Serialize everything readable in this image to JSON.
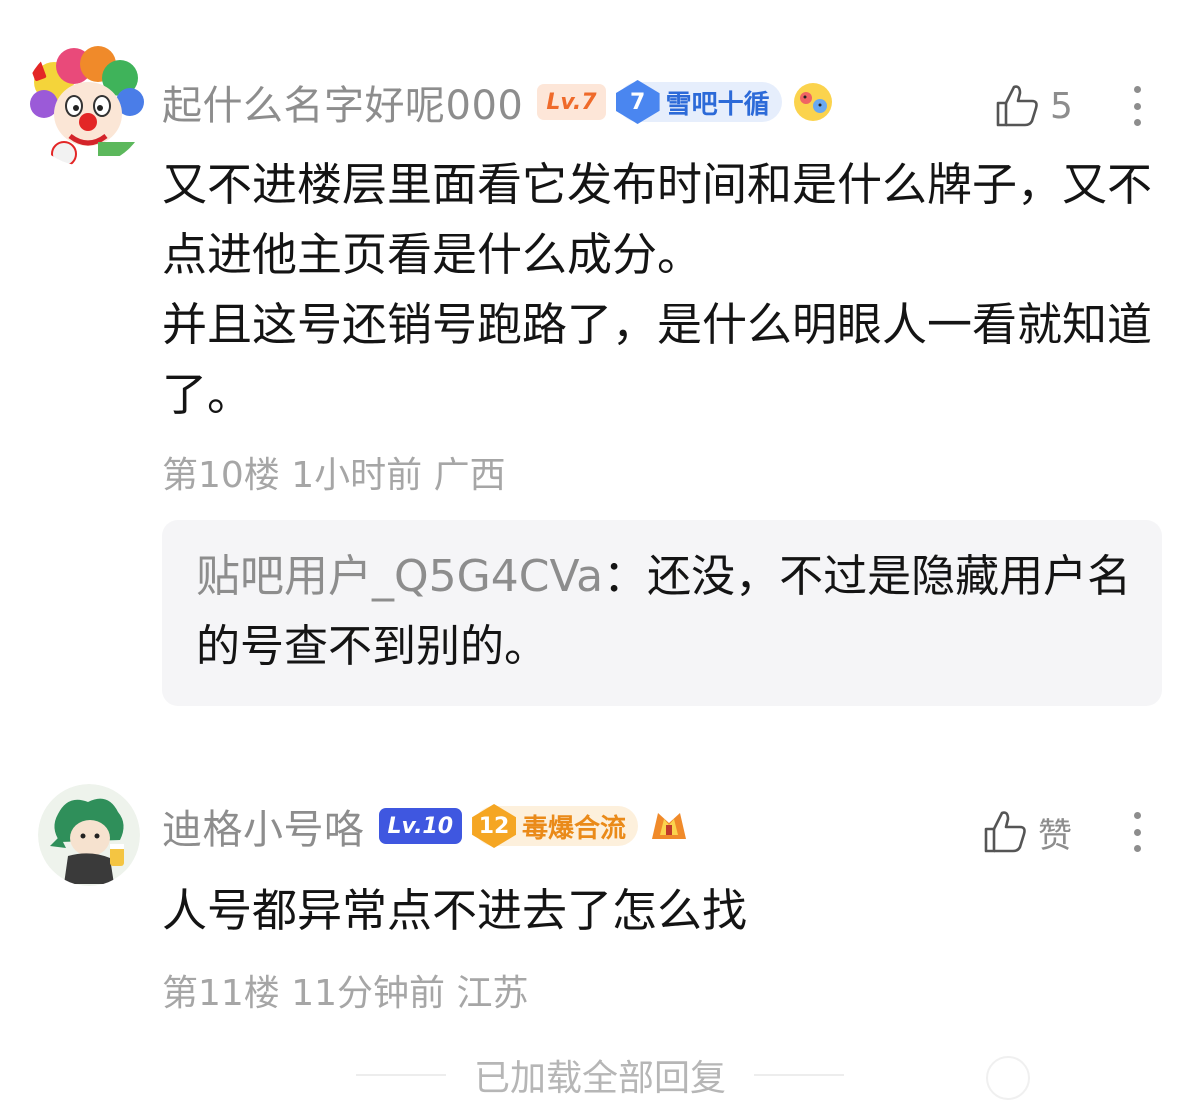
{
  "comments": [
    {
      "username": "起什么名字好呢000",
      "level": "Lv.7",
      "fan_badge": {
        "level": "7",
        "name": "雪吧十循"
      },
      "like_count": "5",
      "body": [
        "又不进楼层里面看它发布时间和是什么牌子，又不点进他主页看是什么成分。",
        "并且这号还销号跑路了，是什么明眼人一看就知道了。"
      ],
      "meta": "第10楼 1小时前 广西",
      "reply": {
        "author": "贴吧用户_Q5G4CVa",
        "separator": "：",
        "text": "还没，不过是隐藏用户名的号查不到别的。"
      }
    },
    {
      "username": "迪格小号咯",
      "level": "Lv.10",
      "fan_badge": {
        "level": "12",
        "name": "毒爆合流"
      },
      "like_count": "赞",
      "body": [
        "人号都异常点不进去了怎么找"
      ],
      "meta": "第11楼 11分钟前 江苏"
    }
  ],
  "footer": {
    "loaded_text": "已加载全部回复"
  },
  "colors": {
    "username": "#8d8d8d",
    "body": "#141414",
    "meta": "#a6a6a6",
    "reply_bg": "#f5f5f7",
    "level7_bg": "#fde6d8",
    "level10_bg": "#3f57e0",
    "fan_blue": "#4a86f0",
    "fan_orange": "#f5a623"
  }
}
